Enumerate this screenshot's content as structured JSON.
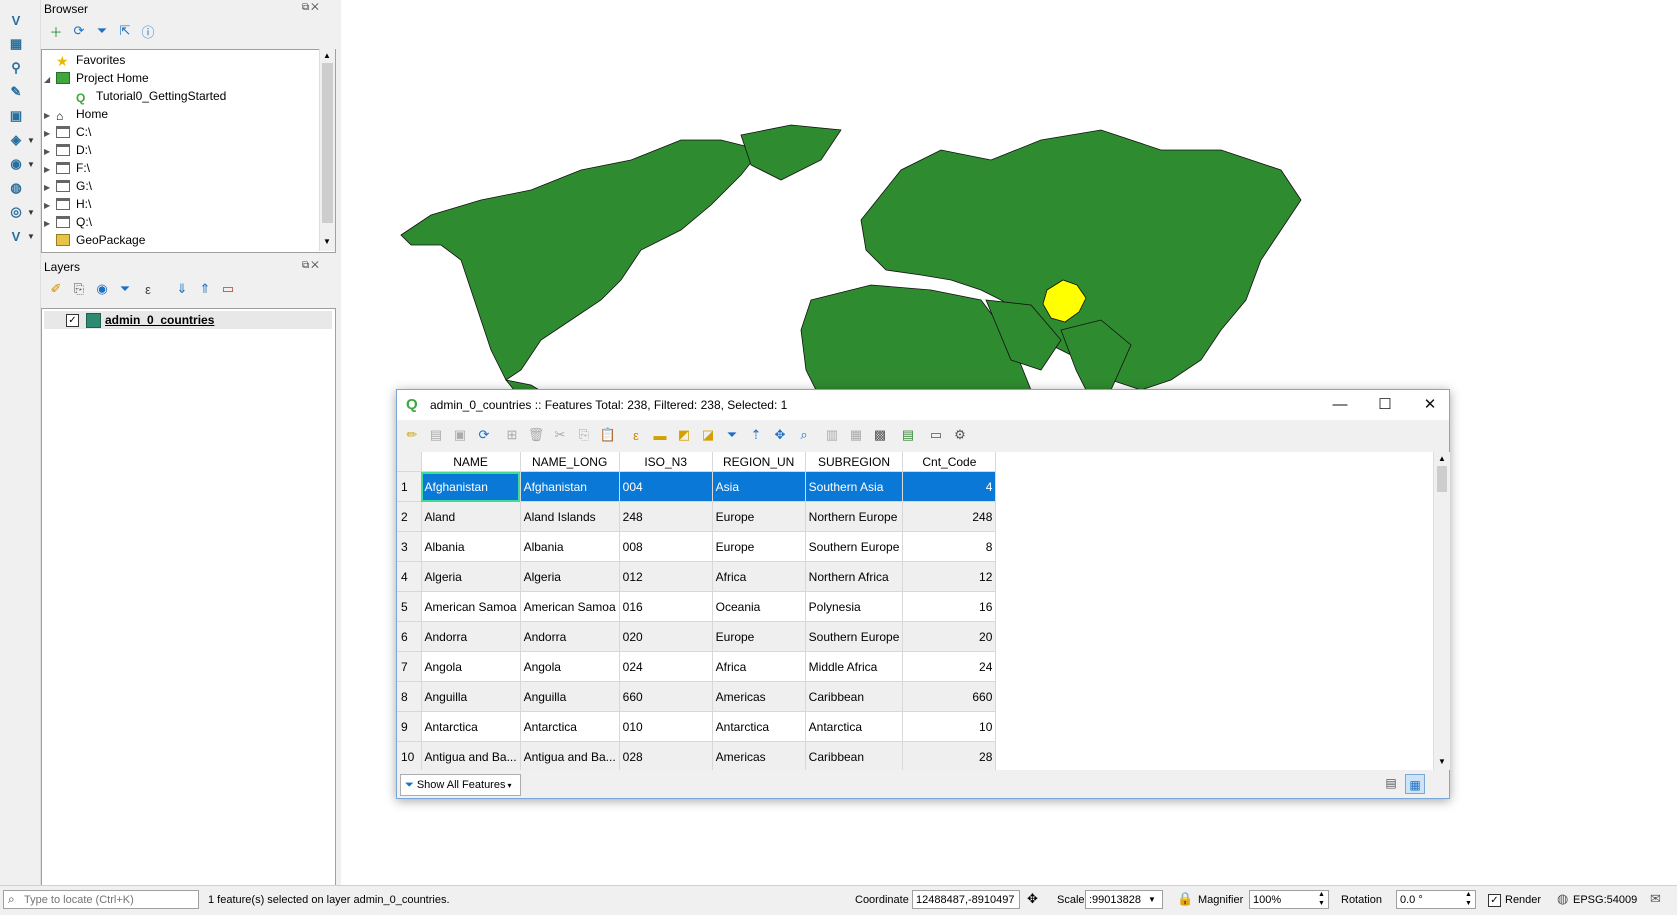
{
  "browser": {
    "title": "Browser",
    "items": [
      {
        "label": "Favorites"
      },
      {
        "label": "Project Home"
      },
      {
        "label": "Tutorial0_GettingStarted"
      },
      {
        "label": "Home"
      },
      {
        "label": "C:\\"
      },
      {
        "label": "D:\\"
      },
      {
        "label": "F:\\"
      },
      {
        "label": "G:\\"
      },
      {
        "label": "H:\\"
      },
      {
        "label": "Q:\\"
      },
      {
        "label": "GeoPackage"
      }
    ]
  },
  "layers": {
    "title": "Layers",
    "items": [
      {
        "label": "admin_0_countries",
        "color": "#2e8b72",
        "checked": true
      }
    ]
  },
  "map": {
    "land_color": "#2f8b2f",
    "border_color": "#111111",
    "selected_color": "#ffff00",
    "background": "#ffffff"
  },
  "attribute_table": {
    "title": "admin_0_countries :: Features Total: 238, Filtered: 238, Selected: 1",
    "columns": [
      "NAME",
      "NAME_LONG",
      "ISO_N3",
      "REGION_UN",
      "SUBREGION",
      "Cnt_Code"
    ],
    "rows": [
      {
        "n": "1",
        "NAME": "Afghanistan",
        "NAME_LONG": "Afghanistan",
        "ISO_N3": "004",
        "REGION_UN": "Asia",
        "SUBREGION": "Southern Asia",
        "Cnt_Code": "4"
      },
      {
        "n": "2",
        "NAME": "Aland",
        "NAME_LONG": "Aland Islands",
        "ISO_N3": "248",
        "REGION_UN": "Europe",
        "SUBREGION": "Northern Europe",
        "Cnt_Code": "248"
      },
      {
        "n": "3",
        "NAME": "Albania",
        "NAME_LONG": "Albania",
        "ISO_N3": "008",
        "REGION_UN": "Europe",
        "SUBREGION": "Southern Europe",
        "Cnt_Code": "8"
      },
      {
        "n": "4",
        "NAME": "Algeria",
        "NAME_LONG": "Algeria",
        "ISO_N3": "012",
        "REGION_UN": "Africa",
        "SUBREGION": "Northern Africa",
        "Cnt_Code": "12"
      },
      {
        "n": "5",
        "NAME": "American Samoa",
        "NAME_LONG": "American Samoa",
        "ISO_N3": "016",
        "REGION_UN": "Oceania",
        "SUBREGION": "Polynesia",
        "Cnt_Code": "16"
      },
      {
        "n": "6",
        "NAME": "Andorra",
        "NAME_LONG": "Andorra",
        "ISO_N3": "020",
        "REGION_UN": "Europe",
        "SUBREGION": "Southern Europe",
        "Cnt_Code": "20"
      },
      {
        "n": "7",
        "NAME": "Angola",
        "NAME_LONG": "Angola",
        "ISO_N3": "024",
        "REGION_UN": "Africa",
        "SUBREGION": "Middle Africa",
        "Cnt_Code": "24"
      },
      {
        "n": "8",
        "NAME": "Anguilla",
        "NAME_LONG": "Anguilla",
        "ISO_N3": "660",
        "REGION_UN": "Americas",
        "SUBREGION": "Caribbean",
        "Cnt_Code": "660"
      },
      {
        "n": "9",
        "NAME": "Antarctica",
        "NAME_LONG": "Antarctica",
        "ISO_N3": "010",
        "REGION_UN": "Antarctica",
        "SUBREGION": "Antarctica",
        "Cnt_Code": "10"
      },
      {
        "n": "10",
        "NAME": "Antigua and Ba...",
        "NAME_LONG": "Antigua and Ba...",
        "ISO_N3": "028",
        "REGION_UN": "Americas",
        "SUBREGION": "Caribbean",
        "Cnt_Code": "28"
      }
    ],
    "filter_label": "Show All Features"
  },
  "statusbar": {
    "locate_placeholder": "Type to locate (Ctrl+K)",
    "message": "1 feature(s) selected on layer admin_0_countries.",
    "coordinate_label": "Coordinate",
    "coordinate_value": "12488487,-8910497",
    "scale_label": "Scale",
    "scale_value": ":99013828",
    "magnifier_label": "Magnifier",
    "magnifier_value": "100%",
    "rotation_label": "Rotation",
    "rotation_value": "0.0 °",
    "render_label": "Render",
    "crs": "EPSG:54009"
  }
}
